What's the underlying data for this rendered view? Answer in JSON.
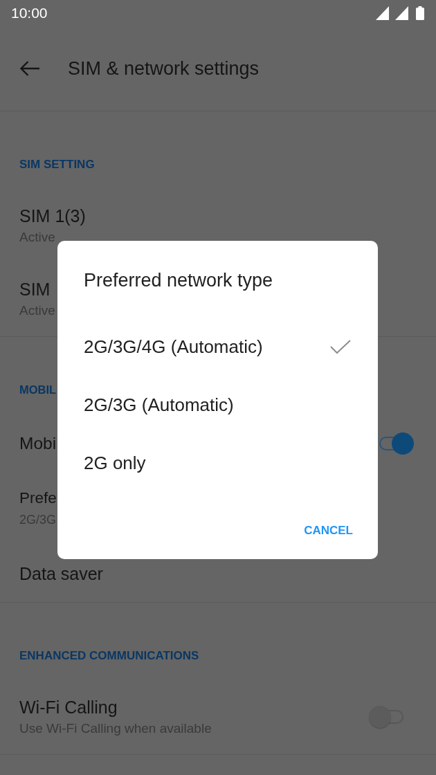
{
  "status_bar": {
    "time": "10:00"
  },
  "toolbar": {
    "title": "SIM & network settings"
  },
  "sections": [
    {
      "header": "SIM SETTING",
      "items": [
        {
          "kind": "text",
          "title": "SIM 1(3)",
          "summary": "Active"
        },
        {
          "kind": "text",
          "title": "SIM",
          "summary": "Active"
        }
      ]
    },
    {
      "header": "MOBIL",
      "items": [
        {
          "kind": "switch",
          "title": "Mobi",
          "on": true
        },
        {
          "kind": "text",
          "title": "Prefe",
          "summary": "2G/3G"
        },
        {
          "kind": "text",
          "title": "Data saver"
        }
      ]
    },
    {
      "header": "ENHANCED COMMUNICATIONS",
      "items": [
        {
          "kind": "switch",
          "title": "Wi-Fi Calling",
          "summary": "Use Wi-Fi Calling when available",
          "on": false
        }
      ]
    }
  ],
  "dialog": {
    "title": "Preferred network type",
    "options": [
      {
        "label": "2G/3G/4G (Automatic)",
        "selected": true
      },
      {
        "label": "2G/3G (Automatic)",
        "selected": false
      },
      {
        "label": "2G only",
        "selected": false
      }
    ],
    "buttons": [
      "CANCEL"
    ]
  }
}
